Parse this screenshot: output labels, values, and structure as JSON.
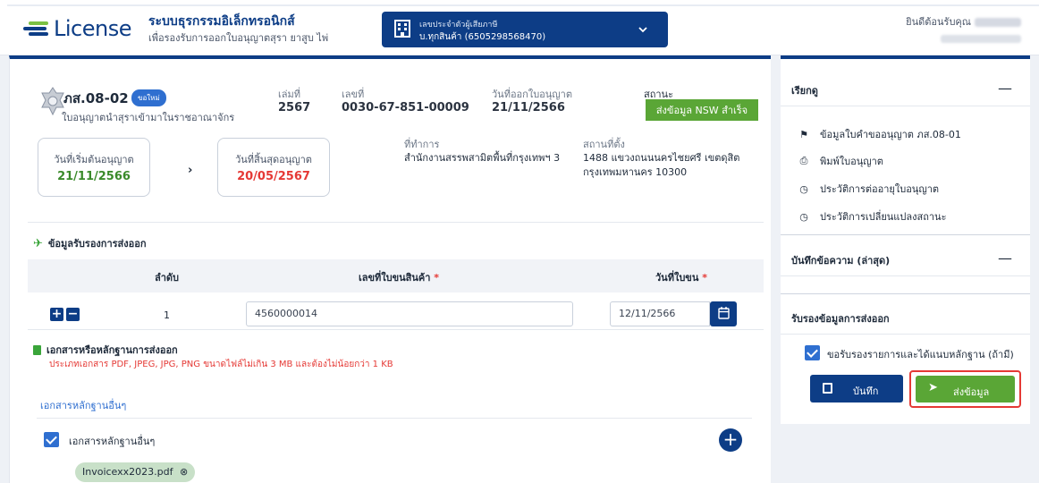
{
  "header": {
    "logo_text": "License",
    "system_title": "ระบบธุรกรรมอิเล็กทรอนิกส์",
    "system_subtitle": "เพื่อรองรับการออกใบอนุญาตสุรา ยาสูบ ไพ่",
    "taxpayer_label": "เลขประจำตัวผู้เสียภาษี",
    "taxpayer_value": "บ.ทุกสินค้า (6505298568470)",
    "welcome_label": "ยินดีต้อนรับคุณ"
  },
  "license": {
    "form_code": "ภส.08-02",
    "badge": "ขอใหม่",
    "description": "ใบอนุญาตนำสุราเข้ามาในราชอาณาจักร",
    "book_label": "เล่มที่",
    "book_value": "2567",
    "number_label": "เลขที่",
    "number_value": "0030-67-851-00009",
    "issue_label": "วันที่ออกใบอนุญาต",
    "issue_value": "21/11/2566",
    "status_label": "สถานะ",
    "status_value": "ส่งข้อมูล NSW สำเร็จ",
    "start_label": "วันที่เริ่มต้นอนุญาต",
    "start_value": "21/11/2566",
    "end_label": "วันที่สิ้นสุดอนุญาต",
    "end_value": "20/05/2567",
    "office_label": "ที่ทำการ",
    "office_value": "สำนักงานสรรพสามิตพื้นที่กรุงเทพฯ 3",
    "location_label": "สถานที่ตั้ง",
    "location_line1": "1488 แขวงถนนนครไชยศรี เขตดุสิต",
    "location_line2": "กรุงเทพมหานคร 10300"
  },
  "export_cert": {
    "title": "ข้อมูลรับรองการส่งออก",
    "col_no": "ลำดับ",
    "col_doc": "เลขที่ใบขนสินค้า",
    "col_date": "วันที่ใบขน",
    "required_mark": "*",
    "rows": [
      {
        "no": "1",
        "doc_no": "4560000014",
        "date": "12/11/2566"
      }
    ]
  },
  "documents": {
    "title": "เอกสารหรือหลักฐานการส่งออก",
    "note": "ประเภทเอกสาร PDF, JPEG, JPG, PNG ขนาดไฟล์ไม่เกิน 3 MB และต้องไม่น้อยกว่า 1 KB",
    "other_link": "เอกสารหลักฐานอื่นๆ",
    "other_checkbox": "เอกสารหลักฐานอื่นๆ",
    "file_name": "Invoicexx2023.pdf"
  },
  "sidebar": {
    "section1_title": "เรียกดู",
    "items": [
      {
        "icon": "flag-icon",
        "label": "ข้อมูลใบคำขออนุญาต ภส.08-01"
      },
      {
        "icon": "print-icon",
        "label": "พิมพ์ใบอนุญาต"
      },
      {
        "icon": "clock-icon",
        "label": "ประวัติการต่ออายุใบอนุญาต"
      },
      {
        "icon": "clock-icon",
        "label": "ประวัติการเปลี่ยนแปลงสถานะ"
      }
    ],
    "section2_title": "บันทึกข้อความ (ล่าสุด)",
    "section3_title": "รับรองข้อมูลการส่งออก",
    "confirm_checkbox": "ขอรับรองรายการและได้แนบหลักฐาน (ถ้ามี)",
    "save_label": "บันทึก",
    "send_label": "ส่งข้อมูล",
    "collapse_symbol": "—"
  },
  "colors": {
    "brand": "#0d3d86",
    "success": "#5aa636",
    "danger": "#e53935",
    "link": "#2f6fd0"
  }
}
